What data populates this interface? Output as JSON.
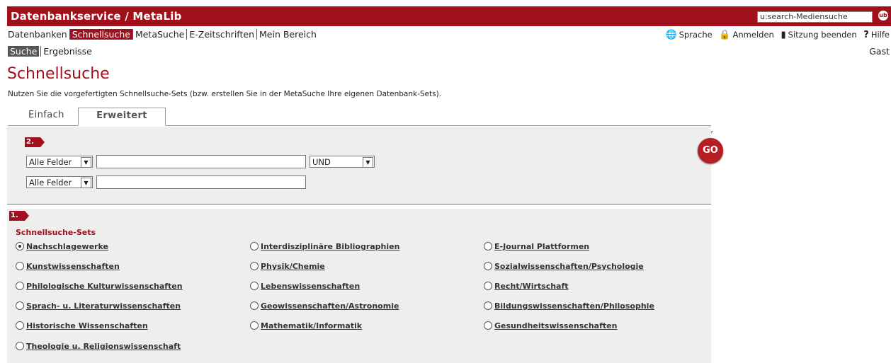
{
  "header": {
    "title": "Datenbankservice / MetaLib",
    "search_value": "u:search-Mediensuche",
    "logo_text": "ub"
  },
  "nav": {
    "items": [
      "Datenbanken",
      "Schnellsuche",
      "MetaSuche",
      "E-Zeitschriften",
      "Mein Bereich"
    ],
    "active": "Schnellsuche",
    "sub_items": [
      "Suche",
      "Ergebnisse"
    ],
    "sub_active": "Suche"
  },
  "utility": {
    "sprache": "Sprache",
    "anmelden": "Anmelden",
    "sitzung": "Sitzung beenden",
    "hilfe": "Hilfe",
    "user": "Gast"
  },
  "page": {
    "title": "Schnellsuche",
    "description": "Nutzen Sie die vorgefertigten Schnellsuche-Sets (bzw. erstellen Sie in der MetaSuche Ihre eigenen Datenbank-Sets)."
  },
  "tabs": {
    "einfach": "Einfach",
    "erweitert": "Erweitert",
    "active": "Erweitert"
  },
  "step2": {
    "badge": "2.",
    "field1": "Alle Felder",
    "field2": "Alle Felder",
    "operator": "UND",
    "go": "GO"
  },
  "step1": {
    "badge": "1.",
    "heading": "Schnellsuche-Sets",
    "selected": "Nachschlagewerke",
    "col1": [
      "Nachschlagewerke",
      "Kunstwissenschaften",
      "Philologische Kulturwissenschaften",
      "Sprach- u. Literaturwissenschaften",
      "Historische Wissenschaften",
      "Theologie u. Religionswissenschaft"
    ],
    "col2": [
      "Interdisziplinäre Bibliographien",
      "Physik/Chemie",
      "Lebenswissenschaften",
      "Geowissenschaften/Astronomie",
      "Mathematik/Informatik"
    ],
    "col3": [
      "E-Journal Plattformen",
      "Sozialwissenschaften/Psychologie",
      "Recht/Wirtschaft",
      "Bildungswissenschaften/Philosophie",
      "Gesundheitswissenschaften"
    ]
  }
}
